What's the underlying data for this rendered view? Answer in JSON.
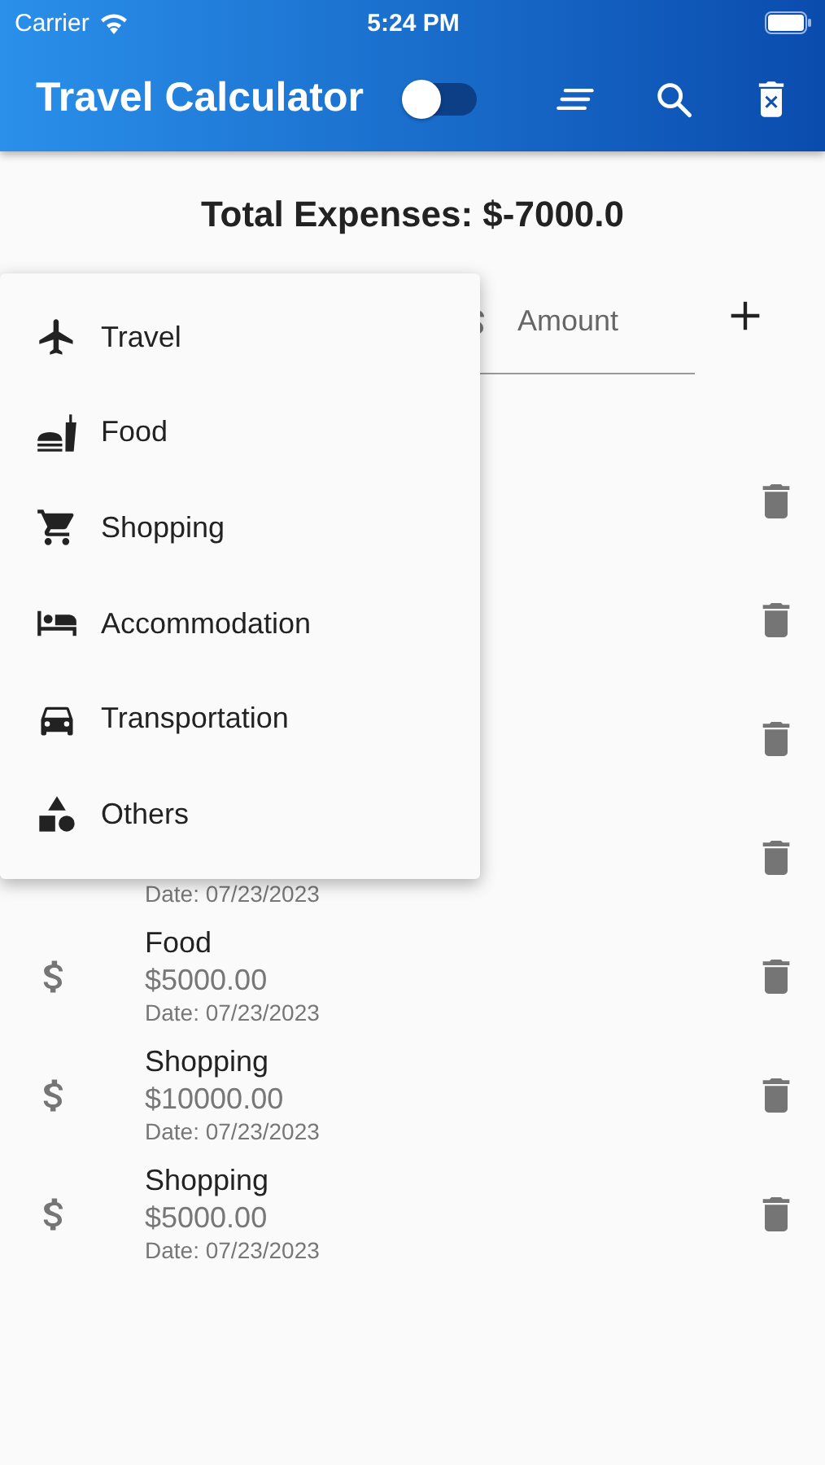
{
  "status_bar": {
    "carrier": "Carrier",
    "time": "5:24 PM"
  },
  "app_bar": {
    "title": "Travel Calculator",
    "theme_toggle": {
      "on": false
    }
  },
  "total": "Total Expenses: $-7000.0",
  "form": {
    "amount": {
      "placeholder": "Amount"
    }
  },
  "expenses": [
    {
      "kind": "covered"
    },
    {
      "kind": "covered"
    },
    {
      "kind": "covered"
    },
    {
      "kind": "entry",
      "date": "Date: 07/23/2023"
    },
    {
      "kind": "entry",
      "category": "Food",
      "amount": "$5000.00",
      "date": "Date: 07/23/2023"
    },
    {
      "kind": "entry",
      "category": "Shopping",
      "amount": "$10000.00",
      "date": "Date: 07/23/2023"
    },
    {
      "kind": "entry",
      "category": "Shopping",
      "amount": "$5000.00",
      "date": "Date: 07/23/2023"
    }
  ],
  "category_menu": {
    "items": [
      {
        "label": "Travel"
      },
      {
        "label": "Food"
      },
      {
        "label": "Shopping"
      },
      {
        "label": "Accommodation"
      },
      {
        "label": "Transportation"
      },
      {
        "label": "Others"
      }
    ]
  }
}
